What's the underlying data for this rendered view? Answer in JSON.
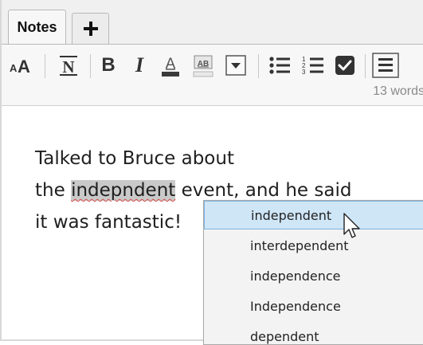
{
  "tabs": {
    "active_label": "Notes",
    "add_icon": "plus-icon"
  },
  "toolbar": {
    "buttons": [
      {
        "name": "font-size-button",
        "icon": "font-size-icon",
        "text": "AA"
      },
      {
        "name": "normal-text-button",
        "icon": "normal-style-icon",
        "text": "N"
      },
      {
        "name": "bold-button",
        "icon": "bold-icon",
        "text": "B"
      },
      {
        "name": "italic-button",
        "icon": "italic-icon",
        "text": "I"
      },
      {
        "name": "font-color-button",
        "icon": "font-color-icon",
        "text": "A"
      },
      {
        "name": "highlight-button",
        "icon": "highlight-icon",
        "text": "AB"
      },
      {
        "name": "dropdown-button",
        "icon": "chevron-down-icon"
      },
      {
        "name": "bulleted-list-button",
        "icon": "bulleted-list-icon"
      },
      {
        "name": "numbered-list-button",
        "icon": "numbered-list-icon"
      },
      {
        "name": "checkbox-button",
        "icon": "checkbox-icon"
      },
      {
        "name": "align-button",
        "icon": "align-icon"
      }
    ],
    "word_count": "13 words"
  },
  "editor": {
    "line1": "Talked to Bruce about",
    "line2_pre": "the ",
    "line2_misspelled": "indepndent",
    "line2_post": " event, and he said",
    "line3": "it was fantastic!"
  },
  "suggestions": {
    "items": [
      "independent",
      "interdependent",
      "independence",
      "Independence",
      "dependent"
    ],
    "selected_index": 0
  },
  "colors": {
    "selected_bg": "#cfe6f7",
    "selected_border": "#7db4e0",
    "misspelled_highlight": "#c9c9c9",
    "spell_underline": "#d84a4a"
  }
}
